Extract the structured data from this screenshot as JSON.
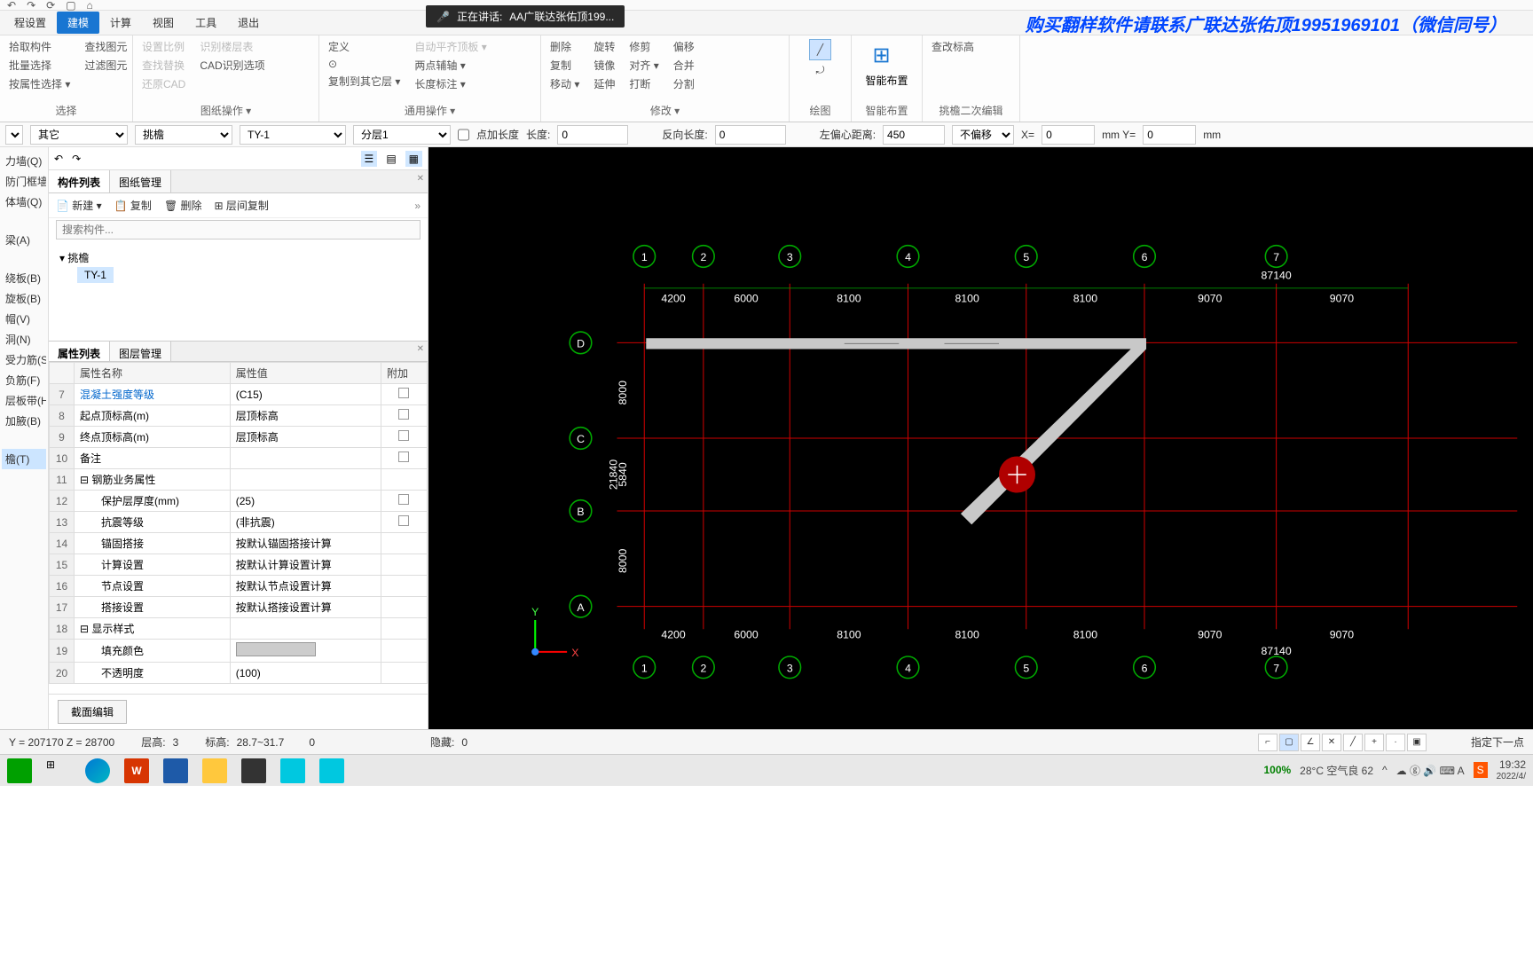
{
  "banner": "购买翻样软件请联系广联达张佑顶19951969101（微信同号）",
  "meeting": {
    "status": "正在讲话:",
    "name": "AA广联达张佑顶199..."
  },
  "qat": [
    "↶",
    "↷",
    "⟳",
    "▢",
    "⌂"
  ],
  "main_tabs": [
    "程设置",
    "建模",
    "计算",
    "视图",
    "工具",
    "退出"
  ],
  "active_tab": "建模",
  "ribbon": {
    "g1": {
      "items": [
        "拾取构件",
        "批量选择",
        "按属性选择 ▾"
      ],
      "icons": [
        "⬚",
        "⊞",
        "≡"
      ],
      "label": "选择"
    },
    "g2": {
      "items": [
        "查找图元",
        "过滤图元"
      ],
      "icons": [
        "🔍",
        "⊗"
      ]
    },
    "g3": {
      "c1": [
        "设置比例",
        "查找替换",
        "还原CAD"
      ],
      "c2": [
        "识别楼层表",
        "CAD识别选项"
      ],
      "label": "图纸操作 ▾"
    },
    "g4": {
      "c1": [
        "定义",
        "⊙",
        "复制到其它层 ▾"
      ],
      "c2": [
        "自动平齐顶板 ▾",
        "两点辅轴 ▾",
        "长度标注 ▾"
      ],
      "label": "通用操作 ▾"
    },
    "g5": {
      "c1": [
        "删除",
        "复制",
        "移动 ▾"
      ],
      "c2": [
        "旋转",
        "镜像",
        "延伸"
      ],
      "c3": [
        "修剪",
        "对齐 ▾",
        "打断"
      ],
      "c4": [
        "偏移",
        "合并",
        "分割"
      ],
      "label": "修改 ▾"
    },
    "g6": {
      "items": [
        "╱",
        "⤾"
      ],
      "label": "绘图"
    },
    "g7": {
      "label": "智能布置",
      "big": "智能布置"
    },
    "g8": {
      "items": [
        "查改标高"
      ],
      "label": "挑檐二次编辑"
    }
  },
  "options": {
    "sel1": "",
    "sel2": "其它",
    "sel3": "挑檐",
    "sel4": "TY-1",
    "sel5": "分层1",
    "chk_label": "点加长度",
    "len_label": "长度:",
    "len_val": "0",
    "rev_label": "反向长度:",
    "rev_val": "0",
    "off_label": "左偏心距离:",
    "off_val": "450",
    "shift_sel": "不偏移",
    "x_label": "X=",
    "x_val": "0",
    "y_label": "mm Y=",
    "y_val": "0",
    "mm": "mm"
  },
  "left_items": [
    "力墙(Q)",
    "防门框墙(RF)",
    "体墙(Q)",
    "",
    "梁(A)",
    "",
    "绕板(B)",
    "旋板(B)",
    "帽(V)",
    "洞(N)",
    "受力筋(S)",
    "负筋(F)",
    "层板带(H)",
    "加腋(B)",
    "",
    "檐(T)"
  ],
  "left_sel": "檐(T)",
  "nav": {
    "icons": [
      "↶",
      "↷"
    ],
    "toggles": [
      "☰",
      "▤",
      "▦"
    ]
  },
  "comp_list": {
    "tabs": [
      "构件列表",
      "图纸管理"
    ],
    "toolbar": [
      "新建 ▾",
      "复制",
      "删除",
      "层间复制"
    ],
    "search_ph": "搜索构件...",
    "root": "挑檐",
    "child": "TY-1"
  },
  "prop": {
    "tabs": [
      "属性列表",
      "图层管理"
    ],
    "headers": [
      "属性名称",
      "属性值",
      "附加"
    ],
    "rows": [
      {
        "n": "7",
        "name": "混凝土强度等级",
        "val": "(C15)",
        "cb": true,
        "hl": true
      },
      {
        "n": "8",
        "name": "起点顶标高(m)",
        "val": "层顶标高",
        "cb": true
      },
      {
        "n": "9",
        "name": "终点顶标高(m)",
        "val": "层顶标高",
        "cb": true
      },
      {
        "n": "10",
        "name": "备注",
        "val": "",
        "cb": true
      },
      {
        "n": "11",
        "name": "钢筋业务属性",
        "val": "",
        "grp": true
      },
      {
        "n": "12",
        "name": "保护层厚度(mm)",
        "val": "(25)",
        "cb": true,
        "indent": true
      },
      {
        "n": "13",
        "name": "抗震等级",
        "val": "(非抗震)",
        "cb": true,
        "indent": true
      },
      {
        "n": "14",
        "name": "锚固搭接",
        "val": "按默认锚固搭接计算",
        "indent": true
      },
      {
        "n": "15",
        "name": "计算设置",
        "val": "按默认计算设置计算",
        "indent": true
      },
      {
        "n": "16",
        "name": "节点设置",
        "val": "按默认节点设置计算",
        "indent": true
      },
      {
        "n": "17",
        "name": "搭接设置",
        "val": "按默认搭接设置计算",
        "indent": true
      },
      {
        "n": "18",
        "name": "显示样式",
        "val": "",
        "grp": true
      },
      {
        "n": "19",
        "name": "填充颜色",
        "val": "__swatch__",
        "indent": true
      },
      {
        "n": "20",
        "name": "不透明度",
        "val": "(100)",
        "indent": true
      }
    ],
    "footer": "截面编辑"
  },
  "chart_data": {
    "type": "plan-grid",
    "col_labels": [
      "1",
      "2",
      "3",
      "4",
      "5",
      "6",
      "7"
    ],
    "col_spans": [
      4200,
      6000,
      8100,
      8100,
      8100,
      9070,
      9070
    ],
    "total_width": 87140,
    "row_labels": [
      "A",
      "B",
      "C",
      "D"
    ],
    "row_spans": [
      8000,
      5840,
      8000
    ],
    "total_height": 21840,
    "element": {
      "type": "beam",
      "from": [
        1,
        "D"
      ],
      "to": [
        6,
        "D"
      ],
      "then_to": [
        4.2,
        "B"
      ],
      "color": "#c8c8c8"
    }
  },
  "status": {
    "coord": "Y = 207170  Z = 28700",
    "floor_l": "层高:",
    "floor_v": "3",
    "elev_l": "标高:",
    "elev_v": "28.7~31.7",
    "deg": "0",
    "hide_l": "隐藏:",
    "hide_v": "0",
    "hint": "指定下一点",
    "zoom": "100%"
  },
  "sys": {
    "weather": "28°C 空气良 62",
    "time": "19:32",
    "date": "2022/4/"
  }
}
